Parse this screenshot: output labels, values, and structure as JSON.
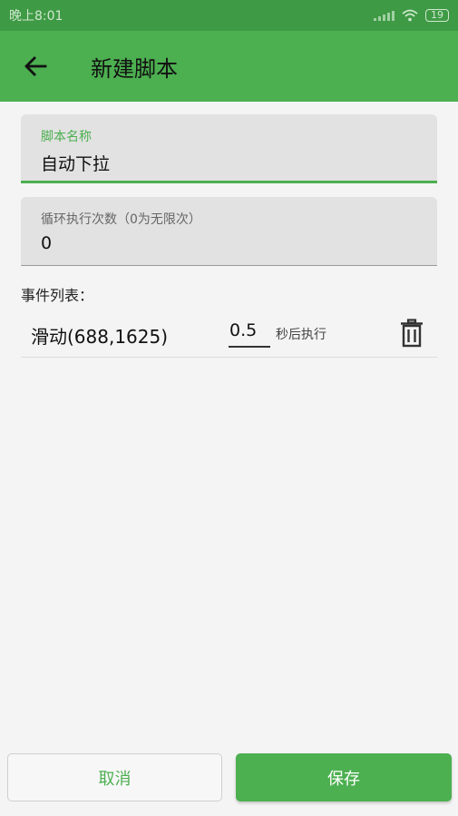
{
  "status_bar": {
    "time": "晚上8:01",
    "battery": "19"
  },
  "app_bar": {
    "title": "新建脚本",
    "back_icon": "arrow-left-icon"
  },
  "form": {
    "name_field": {
      "label": "脚本名称",
      "value": "自动下拉"
    },
    "loop_field": {
      "label": "循环执行次数（0为无限次）",
      "value": "0"
    }
  },
  "events": {
    "title": "事件列表：",
    "items": [
      {
        "name": "滑动(688,1625)",
        "delay": "0.5",
        "delay_unit": "秒后执行",
        "delete_icon": "trash-icon"
      }
    ]
  },
  "actions": {
    "cancel_label": "取消",
    "save_label": "保存"
  },
  "colors": {
    "primary": "#4caf50",
    "status_bar": "#3f9a45",
    "background": "#f4f4f4",
    "field_bg": "#e2e2e2"
  }
}
